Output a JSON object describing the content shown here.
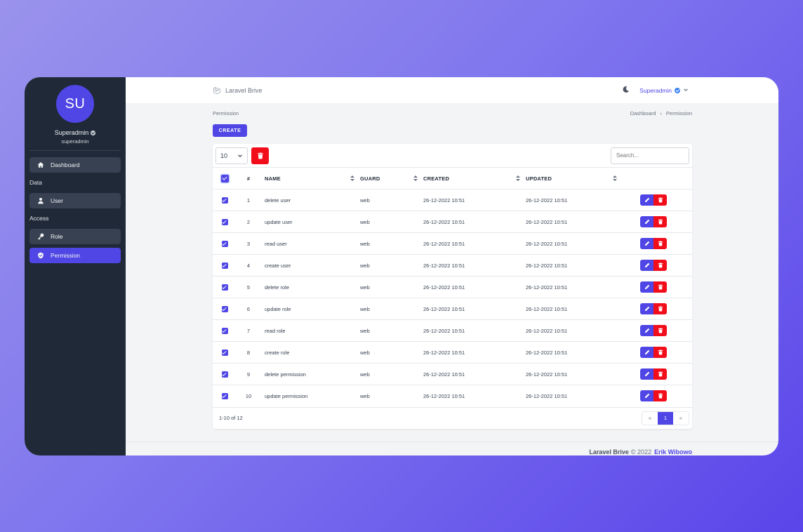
{
  "sidebar": {
    "avatar_initials": "SU",
    "user_name": "Superadmin",
    "user_handle": "superadmin",
    "sections": [
      {
        "label": "",
        "items": [
          {
            "label": "Dashboard",
            "icon": "home-icon",
            "active": false
          }
        ]
      },
      {
        "label": "Data",
        "items": [
          {
            "label": "User",
            "icon": "user-icon",
            "active": false
          }
        ]
      },
      {
        "label": "Access",
        "items": [
          {
            "label": "Role",
            "icon": "key-icon",
            "active": false
          },
          {
            "label": "Permission",
            "icon": "shield-icon",
            "active": true
          }
        ]
      }
    ]
  },
  "topbar": {
    "brand": "Laravel Brive",
    "user_menu": "Superadmin"
  },
  "page": {
    "title": "Permission",
    "breadcrumb": [
      "Dashboard",
      "Permission"
    ],
    "create_label": "CREATE"
  },
  "table": {
    "per_page": "10",
    "search_placeholder": "Search...",
    "headers": {
      "num": "#",
      "name": "NAME",
      "guard": "GUARD",
      "created": "CREATED",
      "updated": "UPDATED"
    },
    "rows": [
      {
        "num": "1",
        "name": "delete user",
        "guard": "web",
        "created": "26-12-2022 10:51",
        "updated": "26-12-2022 10:51"
      },
      {
        "num": "2",
        "name": "update user",
        "guard": "web",
        "created": "26-12-2022 10:51",
        "updated": "26-12-2022 10:51"
      },
      {
        "num": "3",
        "name": "read user",
        "guard": "web",
        "created": "26-12-2022 10:51",
        "updated": "26-12-2022 10:51"
      },
      {
        "num": "4",
        "name": "create user",
        "guard": "web",
        "created": "26-12-2022 10:51",
        "updated": "26-12-2022 10:51"
      },
      {
        "num": "5",
        "name": "delete role",
        "guard": "web",
        "created": "26-12-2022 10:51",
        "updated": "26-12-2022 10:51"
      },
      {
        "num": "6",
        "name": "update role",
        "guard": "web",
        "created": "26-12-2022 10:51",
        "updated": "26-12-2022 10:51"
      },
      {
        "num": "7",
        "name": "read role",
        "guard": "web",
        "created": "26-12-2022 10:51",
        "updated": "26-12-2022 10:51"
      },
      {
        "num": "8",
        "name": "create role",
        "guard": "web",
        "created": "26-12-2022 10:51",
        "updated": "26-12-2022 10:51"
      },
      {
        "num": "9",
        "name": "delete permission",
        "guard": "web",
        "created": "26-12-2022 10:51",
        "updated": "26-12-2022 10:51"
      },
      {
        "num": "10",
        "name": "update permission",
        "guard": "web",
        "created": "26-12-2022 10:51",
        "updated": "26-12-2022 10:51"
      }
    ],
    "count_text": "1-10 of 12",
    "pager": {
      "prev": "«",
      "current": "1",
      "next": "«"
    }
  },
  "footer": {
    "brand": "Laravel Brive",
    "copyright": "© 2022",
    "author": "Erik Wibowo"
  },
  "colors": {
    "primary": "#4f46e5",
    "danger": "#f20d1a",
    "sidebar": "#1f2937"
  }
}
